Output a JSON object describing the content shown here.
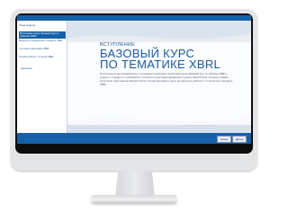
{
  "sidebar": {
    "header": "Тема модуля",
    "items": [
      {
        "label": "Вступление в курс. Базовый курс по тематике XBRL",
        "active": true
      },
      {
        "label": "Вопросы по внедрению стандарта XBRL"
      },
      {
        "label": "Что такое таксономия XBRL"
      },
      {
        "label": "Основы работы с отчетом XBRL"
      }
    ],
    "footer": "Навигация"
  },
  "slide": {
    "kicker": "ВСТУПЛЕНИЕ",
    "title_line1": "БАЗОВЫЙ КУРС",
    "title_line2": "ПО ТЕМАТИКЕ XBRL",
    "description": "В этом модуле вы познакомитесь с основными понятиями и вопросами курса «Базовый курс по тематике XBRL», узнаете о стандарте и требованиях к отчетности участников финансового рынка в Банк России, которые в рамках курса были подготовлены Банком России. Изучив материалы курса, вы научитесь работать с отчетностью в формате XBRL."
  },
  "controls": {
    "prev_label": "Назад",
    "next_label": "Далее"
  },
  "colors": {
    "accent": "#1660a8",
    "title": "#1d5a99"
  }
}
